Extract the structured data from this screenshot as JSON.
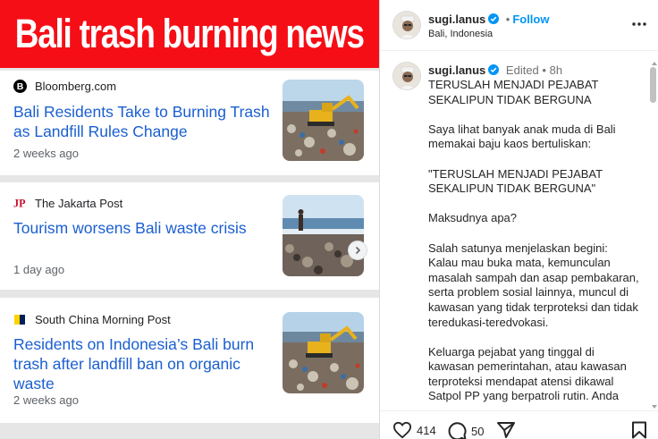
{
  "banner": {
    "title": "Bali trash burning news"
  },
  "news": [
    {
      "source": "Bloomberg.com",
      "source_logo": "bloomberg-b-icon",
      "headline": "Bali Residents Take to Burning Trash as Landfill Rules Change",
      "age": "2 weeks ago",
      "thumb": "excavator-landfill-image"
    },
    {
      "source": "The Jakarta Post",
      "source_logo": "jakarta-post-jp-icon",
      "headline": "Tourism worsens Bali waste crisis",
      "age": "1 day ago",
      "thumb": "person-on-trash-beach-image"
    },
    {
      "source": "South China Morning Post",
      "source_logo": "scmp-icon",
      "headline": "Residents on Indonesia’s Bali burn trash after landfill ban on organic waste",
      "age": "2 weeks ago",
      "thumb": "excavator-landfill-image"
    }
  ],
  "post": {
    "username": "sugi.lanus",
    "follow_label": "Follow",
    "location": "Bali, Indonesia",
    "edited_label": "Edited",
    "time": "8h",
    "caption": "TERUSLAH MENJADI PEJABAT\nSEKALIPUN TIDAK BERGUNA\n\nSaya lihat banyak anak muda di Bali memakai baju kaos bertuliskan:\n\n\"TERUSLAH MENJADI PEJABAT SEKALIPUN TIDAK BERGUNA\"\n\nMaksudnya apa?\n\nSalah satunya menjelaskan begini: Kalau mau buka mata, kemunculan masalah sampah dan asap pembakaran, serta problem sosial lainnya, muncul di kawasan yang tidak terproteksi dan tidak teredukasi-teredvokasi.\n\nKeluarga pejabat yang tinggal di kawasan pemerintahan, atau kawasan terproteksi mendapat atensi dikawal Satpol PP yang berpatroli rutin. Anda",
    "likes": "414",
    "comments": "50"
  },
  "colors": {
    "banner_red": "#f50e16",
    "link_blue": "#1a5fd0",
    "follow_blue": "#0095f6",
    "verified_blue": "#0095f6"
  }
}
